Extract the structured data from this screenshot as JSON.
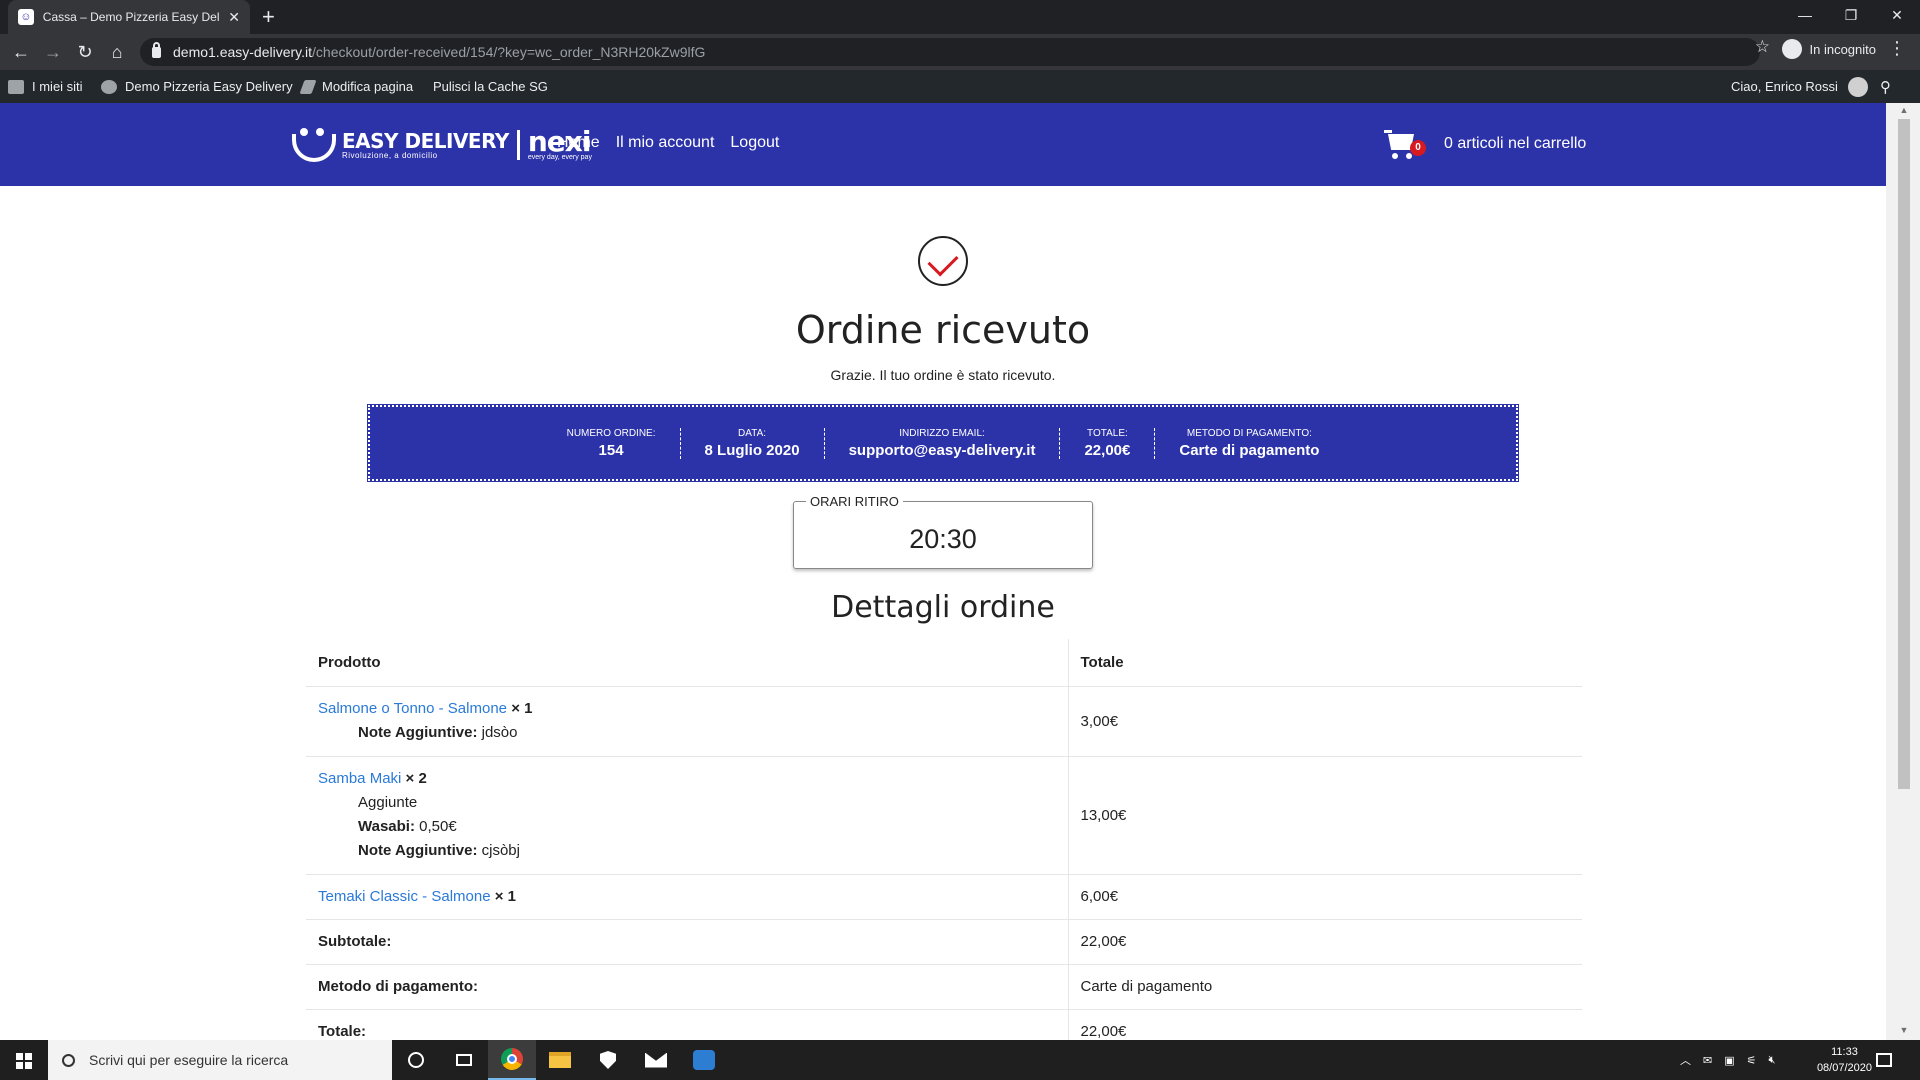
{
  "browser": {
    "tab_title": "Cassa – Demo Pizzeria Easy Deliv",
    "url_host": "demo1.easy-delivery.it",
    "url_path": "/checkout/order-received/154/?key=wc_order_N3RH20kZw9lfG",
    "incognito_label": "In incognito"
  },
  "adminbar": {
    "my_sites": "I miei siti",
    "site_name": "Demo Pizzeria Easy Delivery",
    "edit_page": "Modifica pagina",
    "purge_cache": "Pulisci la Cache SG",
    "greeting": "Ciao, Enrico Rossi"
  },
  "header": {
    "logo_main": "EASY DELIVERY",
    "logo_tagline": "Rivoluzione, a domicilio",
    "logo_partner": "nexi",
    "logo_partner_tagline": "every day, every pay",
    "nav": [
      "Home",
      "Il mio account",
      "Logout"
    ],
    "cart_count": "0",
    "cart_label": "0 articoli nel carrello",
    "brand_color": "#2c32a8"
  },
  "confirmation": {
    "title": "Ordine ricevuto",
    "thanks": "Grazie. Il tuo ordine è stato ricevuto."
  },
  "overview": [
    {
      "label": "NUMERO ORDINE:",
      "value": "154"
    },
    {
      "label": "DATA:",
      "value": "8 Luglio 2020"
    },
    {
      "label": "INDIRIZZO EMAIL:",
      "value": "supporto@easy-delivery.it"
    },
    {
      "label": "TOTALE:",
      "value": "22,00€"
    },
    {
      "label": "METODO DI PAGAMENTO:",
      "value": "Carte di pagamento"
    }
  ],
  "pickup": {
    "label": "ORARI RITIRO",
    "time": "20:30"
  },
  "details": {
    "title": "Dettagli ordine",
    "col_product": "Prodotto",
    "col_total": "Totale",
    "items": [
      {
        "name": "Salmone o Tonno - Salmone",
        "qty": "× 1",
        "total": "3,00€",
        "note_label": "Note Aggiuntive:",
        "note_value": "jdsòo"
      },
      {
        "name": "Samba Maki",
        "qty": "× 2",
        "total": "13,00€",
        "addons_label": "Aggiunte",
        "addon_label": "Wasabi:",
        "addon_value": "0,50€",
        "note_label": "Note Aggiuntive:",
        "note_value": "cjsòbj"
      },
      {
        "name": "Temaki Classic - Salmone",
        "qty": "× 1",
        "total": "6,00€"
      }
    ],
    "subtotal_label": "Subtotale:",
    "subtotal_value": "22,00€",
    "payment_label": "Metodo di pagamento:",
    "payment_value": "Carte di pagamento",
    "total_label": "Totale:",
    "total_value": "22,00€"
  },
  "taskbar": {
    "search_placeholder": "Scrivi qui per eseguire la ricerca",
    "time": "11:33",
    "date": "08/07/2020"
  }
}
